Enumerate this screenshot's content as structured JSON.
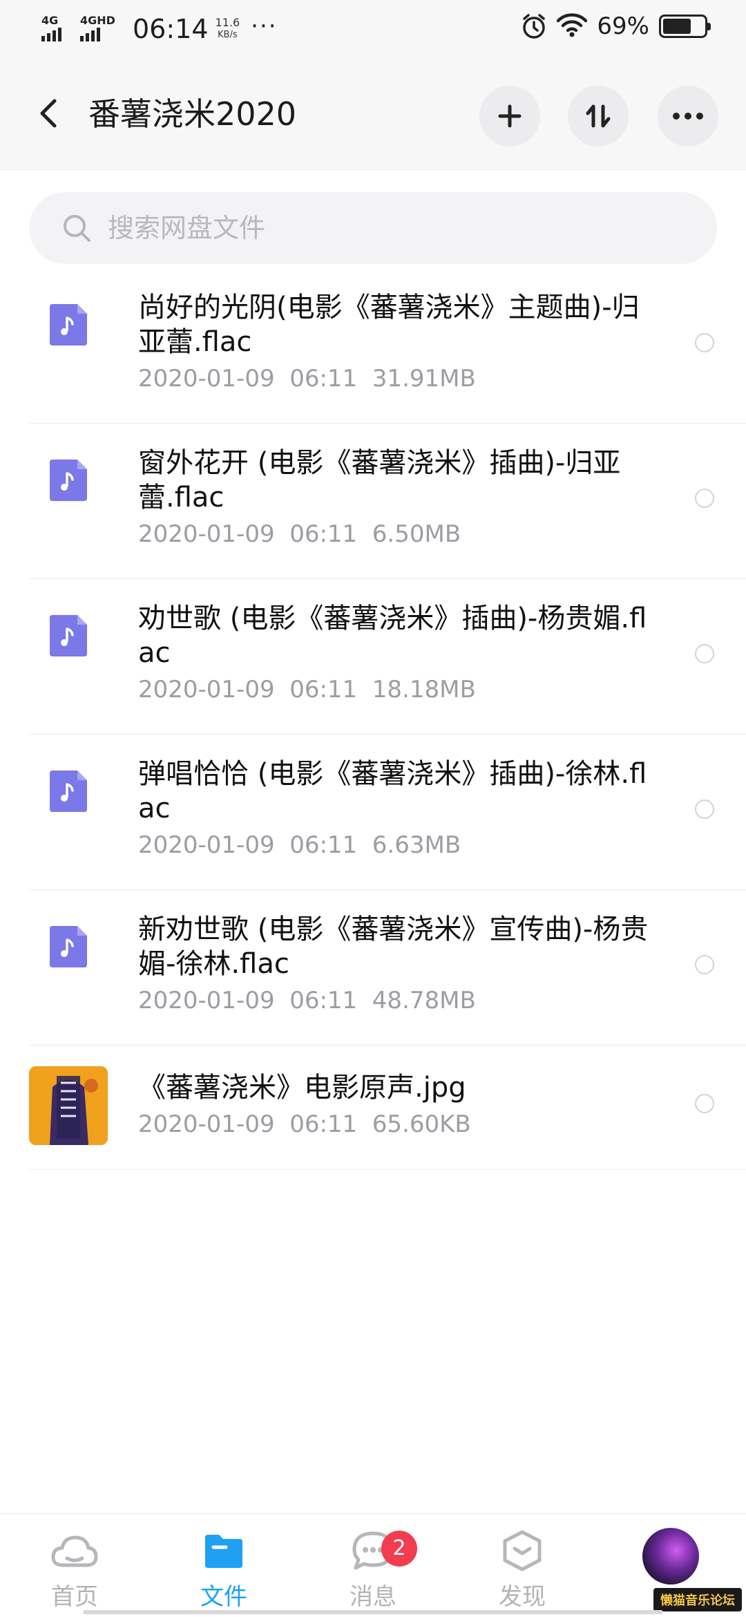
{
  "status_bar": {
    "sig1_label": "4G",
    "sig2_label": "4GHD",
    "time": "06:14",
    "speed_value": "11.6",
    "speed_unit": "KB/s",
    "more": "···",
    "battery_pct": "69%",
    "battery_level": 0.69
  },
  "header": {
    "title": "番薯浇米2020",
    "back_icon": "chevron-left-icon",
    "add_icon": "plus-icon",
    "sort_icon": "sort-icon",
    "more_icon": "more-dots-icon"
  },
  "search": {
    "placeholder": "搜索网盘文件"
  },
  "files": [
    {
      "name": "尚好的光阴(电影《蕃薯浇米》主题曲)-归亚蕾.flac",
      "meta": "2020-01-09  06:11  31.91MB",
      "type": "audio"
    },
    {
      "name": "窗外花开 (电影《蕃薯浇米》插曲)-归亚蕾.flac",
      "meta": "2020-01-09  06:11  6.50MB",
      "type": "audio"
    },
    {
      "name": "劝世歌 (电影《蕃薯浇米》插曲)-杨贵媚.flac",
      "meta": "2020-01-09  06:11  18.18MB",
      "type": "audio"
    },
    {
      "name": "弹唱恰恰 (电影《蕃薯浇米》插曲)-徐林.flac",
      "meta": "2020-01-09  06:11  6.63MB",
      "type": "audio"
    },
    {
      "name": "新劝世歌 (电影《蕃薯浇米》宣传曲)-杨贵媚-徐林.flac",
      "meta": "2020-01-09  06:11  48.78MB",
      "type": "audio"
    },
    {
      "name": "《蕃薯浇米》电影原声.jpg",
      "meta": "2020-01-09  06:11  65.60KB",
      "type": "image"
    }
  ],
  "bottom_nav": {
    "home": "首页",
    "files": "文件",
    "messages": "消息",
    "messages_badge": "2",
    "discover": "发现"
  },
  "watermark": "懒猫音乐论坛",
  "colors": {
    "accent": "#1ea1f2",
    "audio_icon": "#7b78e8",
    "badge": "#f23d51"
  }
}
